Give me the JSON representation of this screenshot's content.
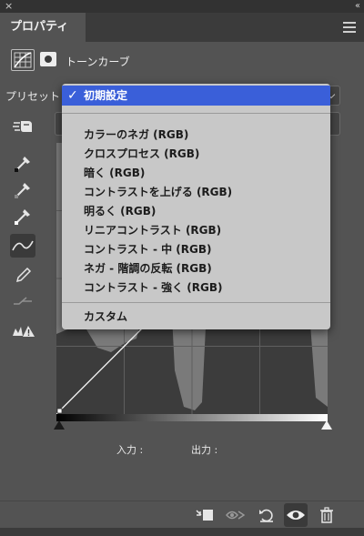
{
  "window": {
    "close_glyph": "×",
    "collapse_glyph": "‹‹"
  },
  "panel": {
    "tab_label": "プロパティ"
  },
  "adjustment": {
    "title": "トーンカーブ"
  },
  "preset": {
    "label": "プリセット :",
    "selected": "初期設定",
    "options": [
      "カラーのネガ (RGB)",
      "クロスプロセス (RGB)",
      "暗く (RGB)",
      "コントラストを上げる (RGB)",
      "明るく (RGB)",
      "リニアコントラスト (RGB)",
      "コントラスト - 中 (RGB)",
      "ネガ - 階調の反転 (RGB)",
      "コントラスト - 強く (RGB)"
    ],
    "custom": "カスタム"
  },
  "io": {
    "input_label": "入力 :",
    "output_label": "出力 :"
  },
  "colors": {
    "panel_bg": "#535353",
    "highlight": "#3a5fd9",
    "menu_bg": "#c8c8c8",
    "histogram": "#3c3c3c"
  },
  "icons": {
    "tools": [
      "auto-adjust-icon",
      "eyedropper-black-icon",
      "eyedropper-gray-icon",
      "eyedropper-white-icon",
      "curve-point-icon",
      "pencil-icon",
      "smooth-curve-icon",
      "clipping-warning-icon"
    ],
    "bottom": [
      "clip-to-layer-icon",
      "view-previous-icon",
      "reset-icon",
      "visibility-icon",
      "trash-icon"
    ]
  }
}
